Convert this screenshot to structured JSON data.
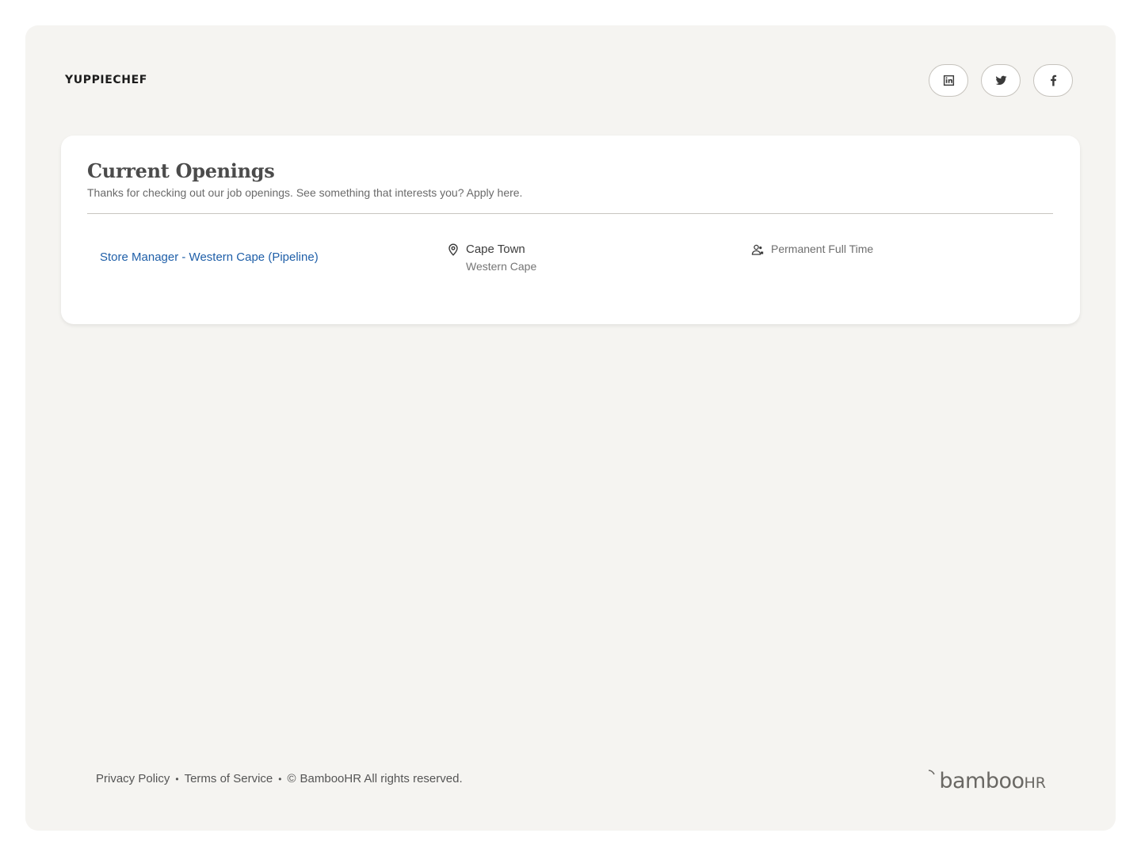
{
  "header": {
    "brand": "YUPPIECHEF",
    "socials": [
      {
        "name": "linkedin",
        "icon": "linkedin-icon"
      },
      {
        "name": "twitter",
        "icon": "twitter-icon"
      },
      {
        "name": "facebook",
        "icon": "facebook-icon"
      }
    ]
  },
  "openings": {
    "title": "Current Openings",
    "subtitle": "Thanks for checking out our job openings. See something that interests you? Apply here.",
    "jobs": [
      {
        "title": "Store Manager - Western Cape (Pipeline)",
        "city": "Cape Town",
        "region": "Western Cape",
        "type": "Permanent Full Time"
      }
    ]
  },
  "footer": {
    "privacy": "Privacy Policy",
    "terms": "Terms of Service",
    "copyright": "BambooHR All rights reserved.",
    "logo_word": "bamboo",
    "logo_suffix": "HR"
  },
  "colors": {
    "link": "#1f5fa8",
    "page_bg": "#f5f4f1",
    "card_bg": "#ffffff"
  }
}
